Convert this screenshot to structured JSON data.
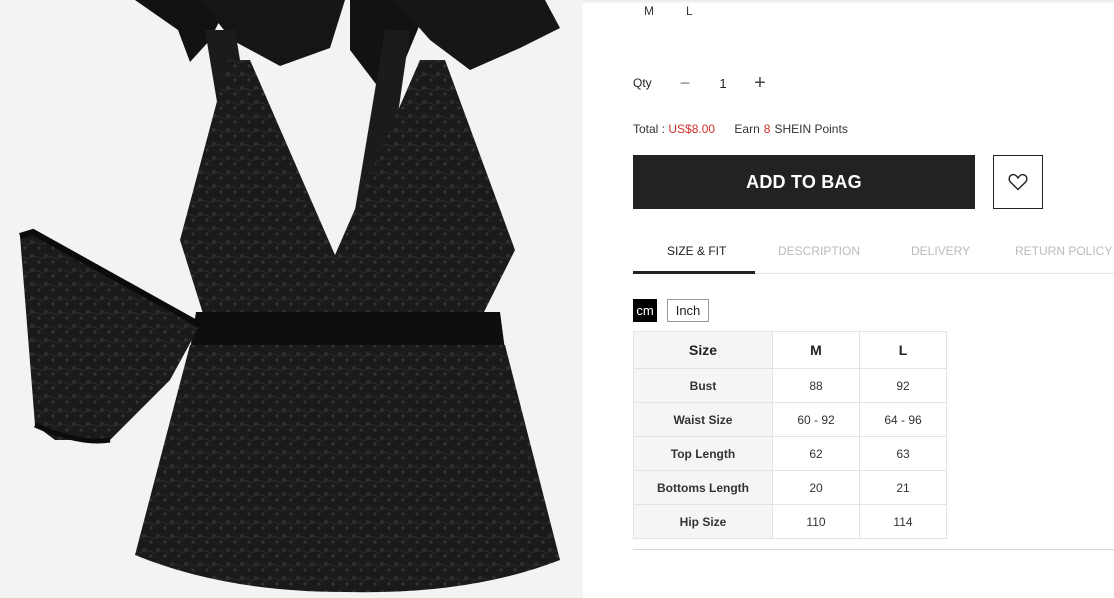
{
  "sizes": [
    "M",
    "L"
  ],
  "quantity": {
    "label": "Qty",
    "minus": "−",
    "value": "1",
    "plus": "+"
  },
  "total": {
    "label": "Total : ",
    "price": "US$8.00"
  },
  "points": {
    "earn": "Earn",
    "count": "8",
    "suffix": "SHEIN Points"
  },
  "buttons": {
    "add_to_bag": "ADD TO BAG"
  },
  "tabs": [
    "SIZE & FIT",
    "DESCRIPTION",
    "DELIVERY",
    "RETURN POLICY"
  ],
  "units": {
    "cm": "cm",
    "inch": "Inch",
    "selected": "cm"
  },
  "size_table": {
    "headers": [
      "Size",
      "M",
      "L"
    ],
    "rows": [
      [
        "Bust",
        "88",
        "92"
      ],
      [
        "Waist Size",
        "60 - 92",
        "64 - 96"
      ],
      [
        "Top Length",
        "62",
        "63"
      ],
      [
        "Bottoms Length",
        "20",
        "21"
      ],
      [
        "Hip Size",
        "110",
        "114"
      ]
    ]
  },
  "colors": {
    "price": "#d0312d",
    "button": "#222222",
    "active_tab": "#222222",
    "inactive_tab": "#bbbbbb"
  },
  "icons": {
    "wishlist": "heart-outline-icon"
  }
}
